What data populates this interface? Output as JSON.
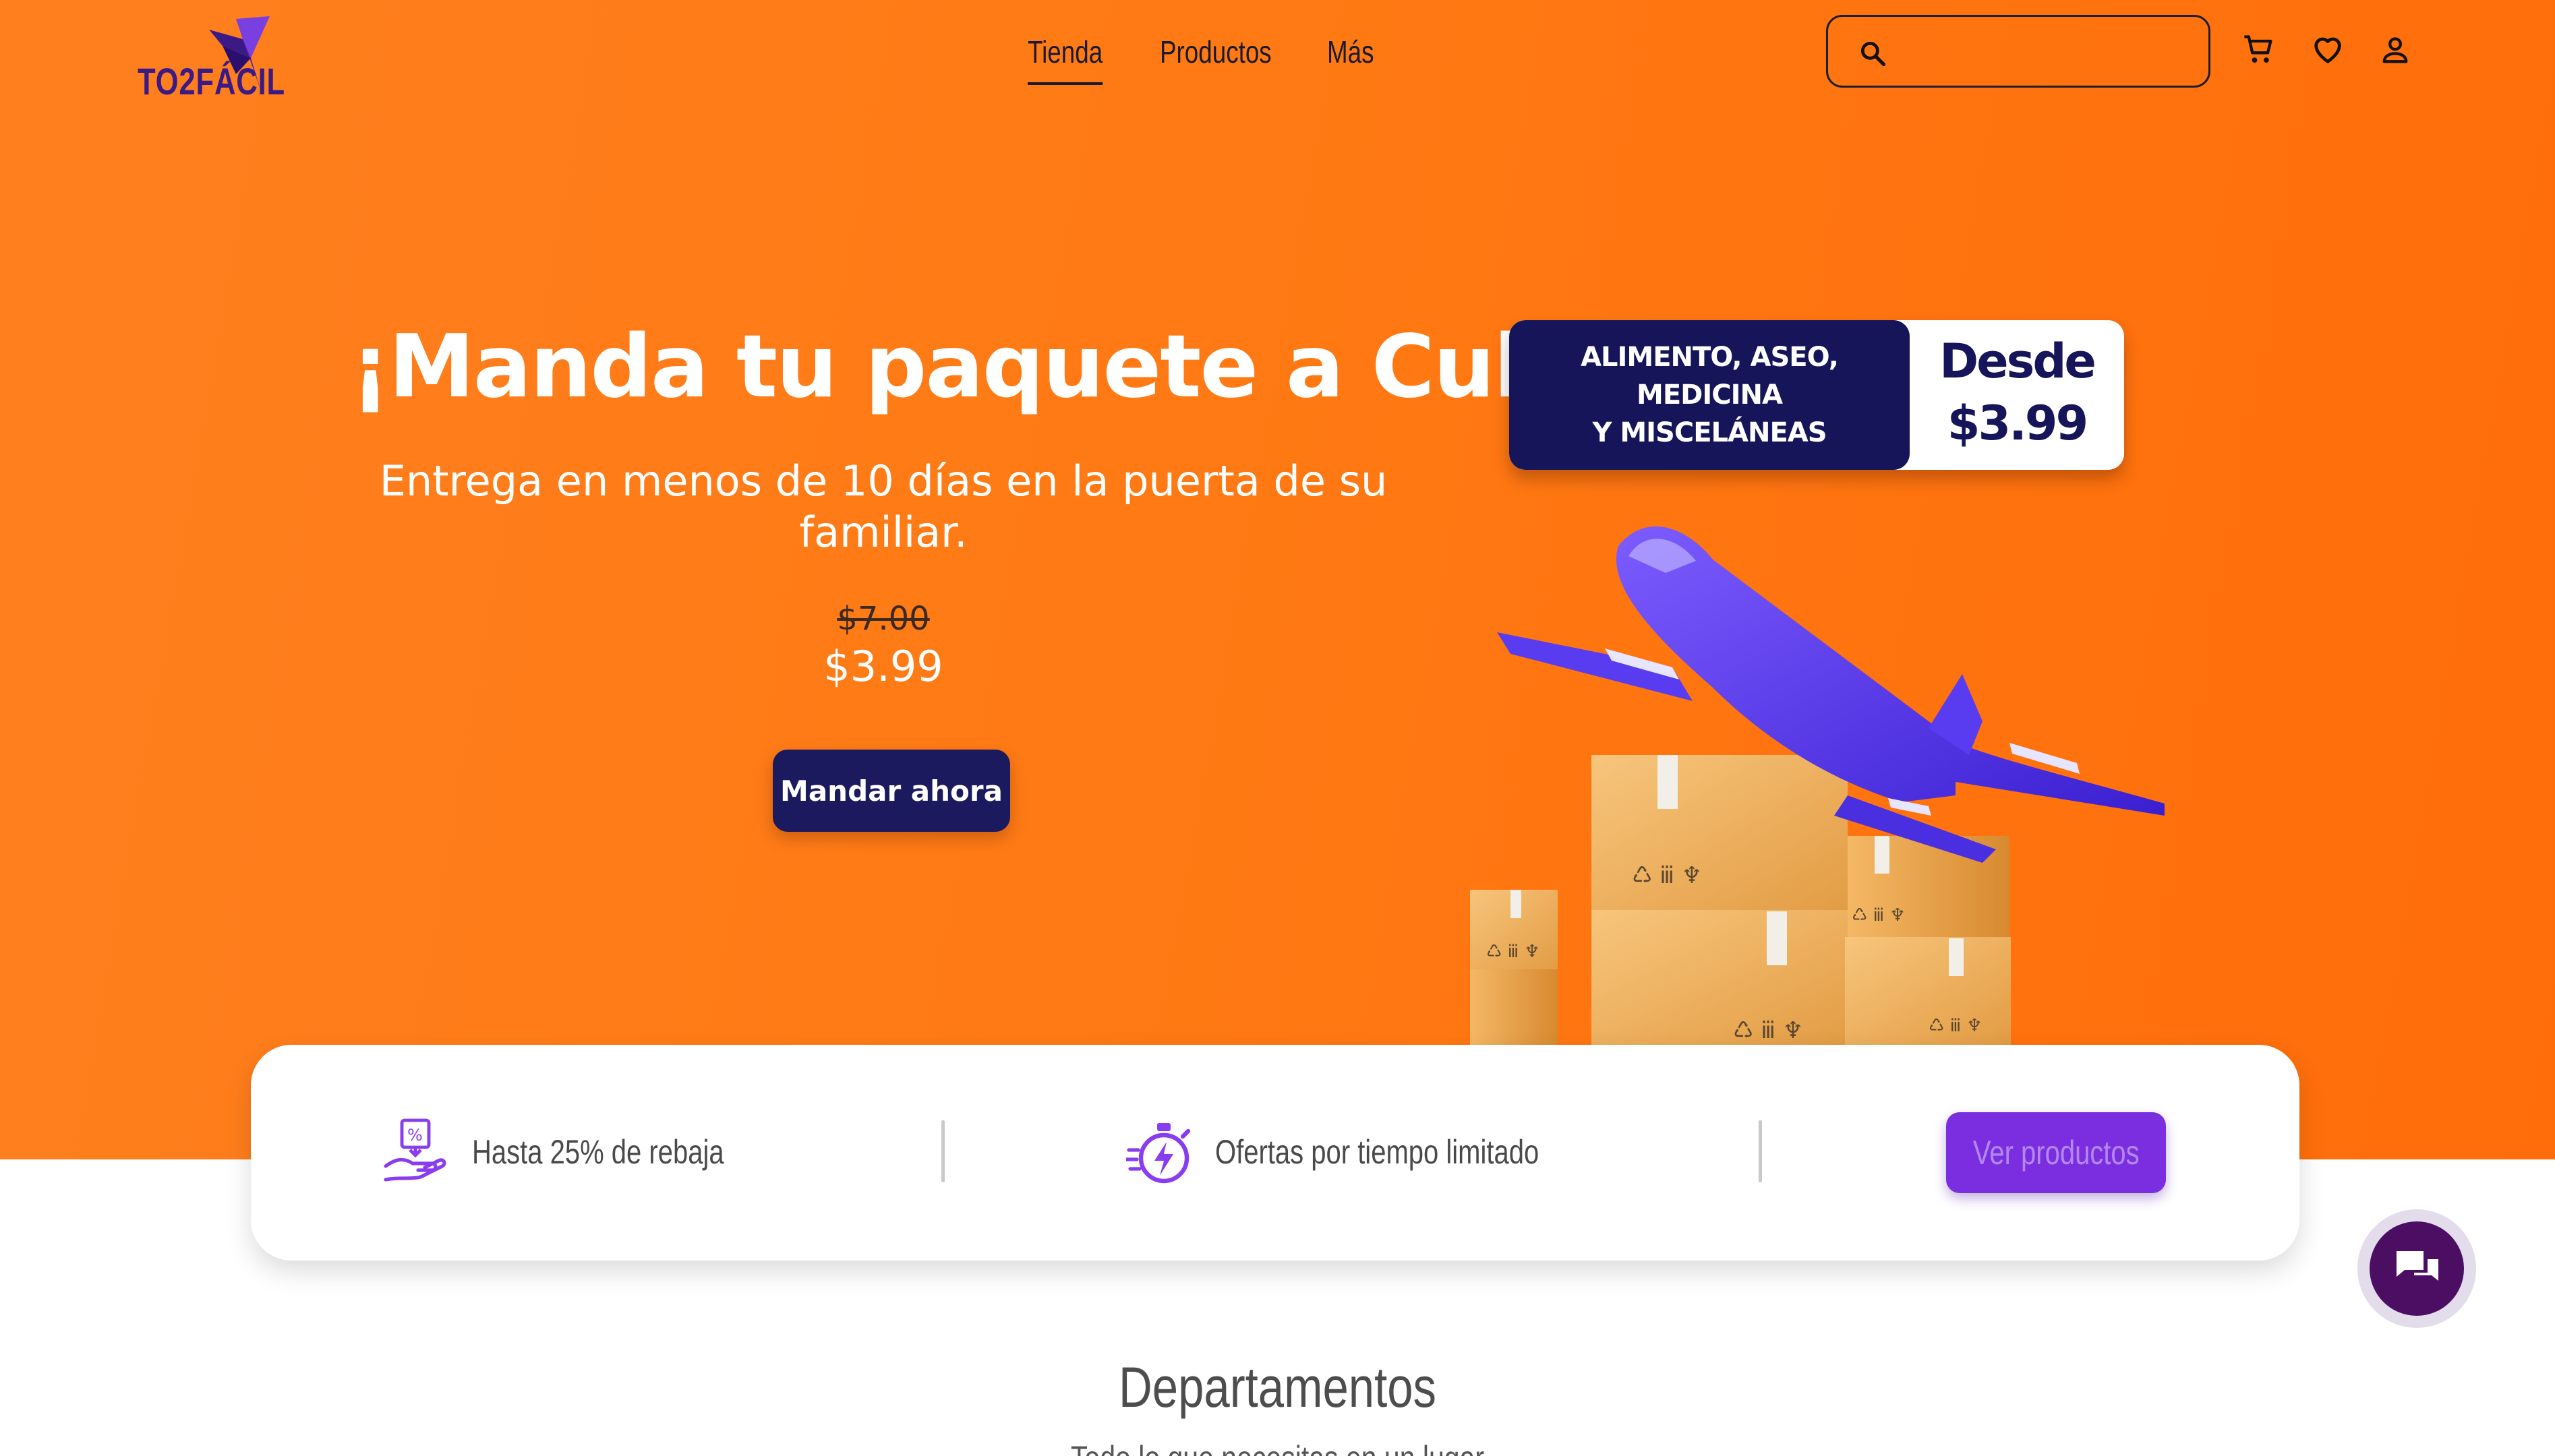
{
  "brand": {
    "logo_text": "TO2FÁCIL",
    "accent": "#3b1a86"
  },
  "nav": {
    "items": [
      "Tienda",
      "Productos",
      "Más"
    ],
    "active": "Tienda"
  },
  "search": {
    "value": "",
    "placeholder": ""
  },
  "header_icons": [
    "search-icon",
    "cart-icon",
    "heart-icon",
    "user-icon"
  ],
  "hero": {
    "title": "¡Manda tu paquete a Cuba!",
    "subtitle": "Entrega en menos de 10 días en la puerta de su familiar.",
    "old_price": "$7.00",
    "new_price": "$3.99",
    "cta_label": "Mandar ahora",
    "background": "#ff7a14"
  },
  "promo": {
    "lines": [
      "ALIMENTO, ASEO,",
      "MEDICINA",
      "Y MISCELÁNEAS"
    ],
    "desde": "Desde",
    "price": "$3.99",
    "navy": "#17155a"
  },
  "features": {
    "discount_text": "Hasta 25% de rebaja",
    "offers_text": "Ofertas por tiempo limitado",
    "button_label": "Ver productos",
    "button_color": "#7b2ee0"
  },
  "section": {
    "title": "Departamentos",
    "subtitle": "Todo lo que necesitas en un lugar"
  }
}
